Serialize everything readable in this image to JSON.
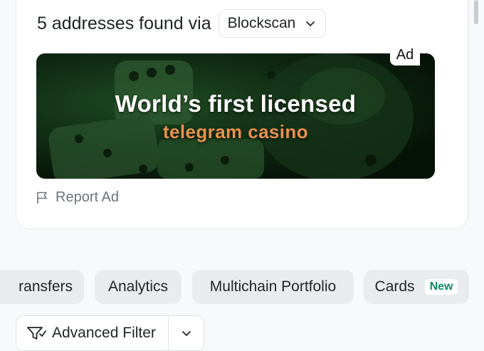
{
  "results": {
    "found_text": "5 addresses found via",
    "source_selected": "Blockscan"
  },
  "ad": {
    "headline": "World’s first licensed",
    "subline": "telegram casino",
    "tag": "Ad",
    "report_label": "Report Ad"
  },
  "tabs": [
    {
      "label": "ransfers"
    },
    {
      "label": "Analytics"
    },
    {
      "label": "Multichain Portfolio"
    },
    {
      "label": "Cards",
      "badge": "New"
    }
  ],
  "filter": {
    "label": "Advanced Filter"
  },
  "colors": {
    "accent_green": "#0e8a66",
    "ad_orange": "#e8914e",
    "tab_bg": "#e9ecef"
  },
  "icons": {
    "source_dropdown": "chevron-down-icon",
    "report": "flag-icon",
    "filter": "filter-icon",
    "filter_toggle": "chevron-down-icon"
  }
}
